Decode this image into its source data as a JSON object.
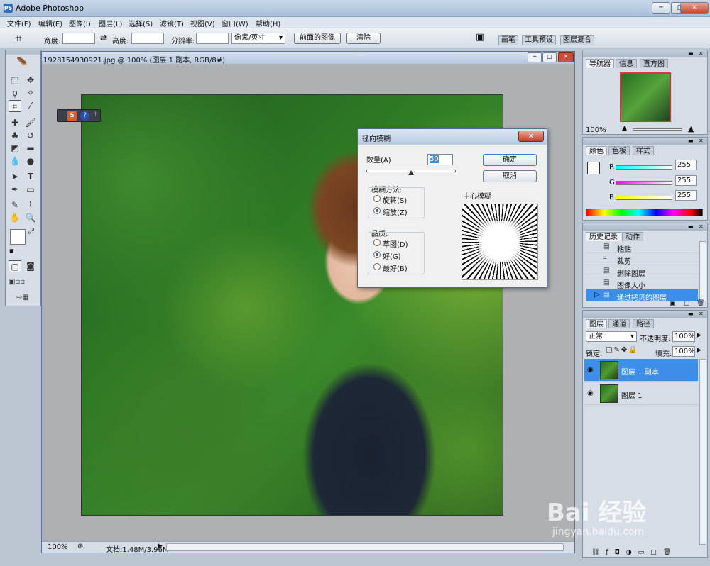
{
  "app": {
    "title": "Adobe Photoshop",
    "logo": "PS"
  },
  "window_controls": {
    "minimize": "─",
    "maximize": "□",
    "close": "✕"
  },
  "menu": [
    "文件(F)",
    "编辑(E)",
    "图像(I)",
    "图层(L)",
    "选择(S)",
    "滤镜(T)",
    "视图(V)",
    "窗口(W)",
    "帮助(H)"
  ],
  "options_bar": {
    "width_label": "宽度:",
    "height_label": "高度:",
    "resolution_label": "分辨率:",
    "unit": "像素/英寸",
    "front_image_button": "前面的图像",
    "clear_button": "清除",
    "well_tabs": [
      "画笔",
      "工具预设",
      "图层复合"
    ]
  },
  "document": {
    "title": "1928154930921.jpg @ 100% (图层 1 副本, RGB/8#)",
    "zoom": "100%",
    "doc_size": "文档:1.48M/3.96M"
  },
  "dialog": {
    "title": "径向模糊",
    "amount_label": "数量(A)",
    "amount_value": "50",
    "amount_fraction": 0.5,
    "ok": "确定",
    "cancel": "取消",
    "method_label": "模糊方法:",
    "method_spin": "旋转(S)",
    "method_zoom": "缩放(Z)",
    "quality_label": "品质:",
    "quality_draft": "草图(D)",
    "quality_good": "好(G)",
    "quality_best": "最好(B)",
    "center_label": "中心模糊"
  },
  "navigator": {
    "tabs": [
      "导航器",
      "信息",
      "直方图"
    ],
    "zoom": "100%"
  },
  "color": {
    "tabs": [
      "颜色",
      "色板",
      "样式"
    ],
    "r_label": "R",
    "g_label": "G",
    "b_label": "B",
    "r": "255",
    "g": "255",
    "b": "255"
  },
  "history": {
    "tabs": [
      "历史记录",
      "动作"
    ],
    "items": [
      "粘贴",
      "裁剪",
      "删除图层",
      "图像大小",
      "通过拷贝的图层"
    ]
  },
  "layers": {
    "tabs": [
      "图层",
      "通道",
      "路径"
    ],
    "blend_mode": "正常",
    "opacity_label": "不透明度:",
    "opacity": "100%",
    "lock_label": "锁定:",
    "fill_label": "填充:",
    "fill": "100%",
    "items": [
      "图层 1 副本",
      "图层 1"
    ]
  },
  "watermark": {
    "main": "Bai 经验",
    "sub": "jingyan.baidu.com"
  },
  "colors": {
    "selection": "#3d8ee8",
    "titlebar": "#b5c8de",
    "close": "#c3422b"
  }
}
